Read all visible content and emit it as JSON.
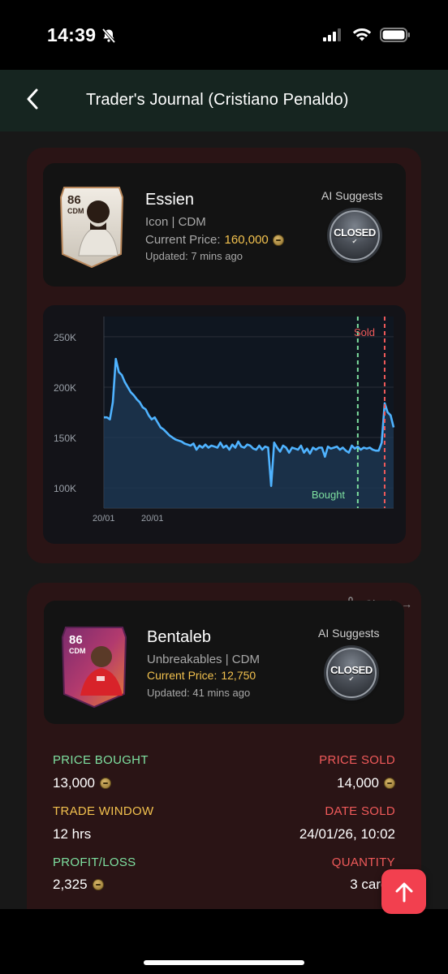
{
  "status_bar": {
    "time": "14:39"
  },
  "header": {
    "title": "Trader's Journal (Cristiano Penaldo)"
  },
  "players": [
    {
      "rating": "86",
      "position": "CDM",
      "name": "Essien",
      "subtitle": "Icon | CDM",
      "price_label": "Current Price:",
      "price_value": "160,000",
      "updated": "Updated: 7 mins ago",
      "ai_label": "AI Suggests",
      "badge": "CLOSED"
    },
    {
      "rating": "86",
      "position": "CDM",
      "name": "Bentaleb",
      "subtitle": "Unbreakables | CDM",
      "price_label": "Current Price:",
      "price_value": "12,750",
      "updated": "Updated: 41 mins ago",
      "ai_label": "AI Suggests",
      "badge": "CLOSED"
    }
  ],
  "charts_link": "Charts →",
  "chart_data": {
    "type": "area",
    "x_tick_labels": [
      "20/01",
      "20/01"
    ],
    "y_ticks": [
      "250K",
      "200K",
      "150K",
      "100K"
    ],
    "ylim": [
      80000,
      270000
    ],
    "markers": [
      {
        "label": "Bought",
        "color": "#7ee0a0",
        "x_index": 85
      },
      {
        "label": "Sold",
        "color": "#f05a5a",
        "x_index": 94
      }
    ],
    "series": [
      {
        "values": [
          170000,
          170000,
          168000,
          185000,
          228000,
          215000,
          212000,
          205000,
          200000,
          195000,
          192000,
          188000,
          185000,
          180000,
          178000,
          172000,
          168000,
          170000,
          165000,
          160000,
          158000,
          155000,
          152000,
          150000,
          148000,
          147000,
          146000,
          144000,
          143000,
          142000,
          144000,
          138000,
          142000,
          140000,
          143000,
          140000,
          142000,
          141000,
          140000,
          145000,
          140000,
          142000,
          138000,
          143000,
          140000,
          146000,
          141000,
          140000,
          143000,
          142000,
          139000,
          138000,
          142000,
          138000,
          141000,
          140000,
          102000,
          145000,
          140000,
          136000,
          142000,
          140000,
          135000,
          140000,
          139000,
          138000,
          142000,
          135000,
          139000,
          134000,
          140000,
          138000,
          140000,
          140000,
          131000,
          141000,
          139000,
          140000,
          141000,
          138000,
          140000,
          137000,
          135000,
          142000,
          139000,
          141000,
          138000,
          140000,
          139000,
          140000,
          138000,
          137000,
          137000,
          145000,
          184000,
          175000,
          172000,
          160000
        ]
      }
    ]
  },
  "trade": {
    "price_bought_label": "PRICE BOUGHT",
    "price_bought": "13,000",
    "price_sold_label": "PRICE SOLD",
    "price_sold": "14,000",
    "trade_window_label": "TRADE WINDOW",
    "trade_window": "12 hrs",
    "date_sold_label": "DATE SOLD",
    "date_sold": "24/01/26, 10:02",
    "profit_loss_label": "PROFIT/LOSS",
    "profit_loss": "2,325",
    "quantity_label": "QUANTITY",
    "quantity": "3 cards"
  },
  "colors": {
    "accent": "#f2404f",
    "line": "#4fb3ff",
    "header_bg": "#162520",
    "card_bg": "#2a1415"
  }
}
